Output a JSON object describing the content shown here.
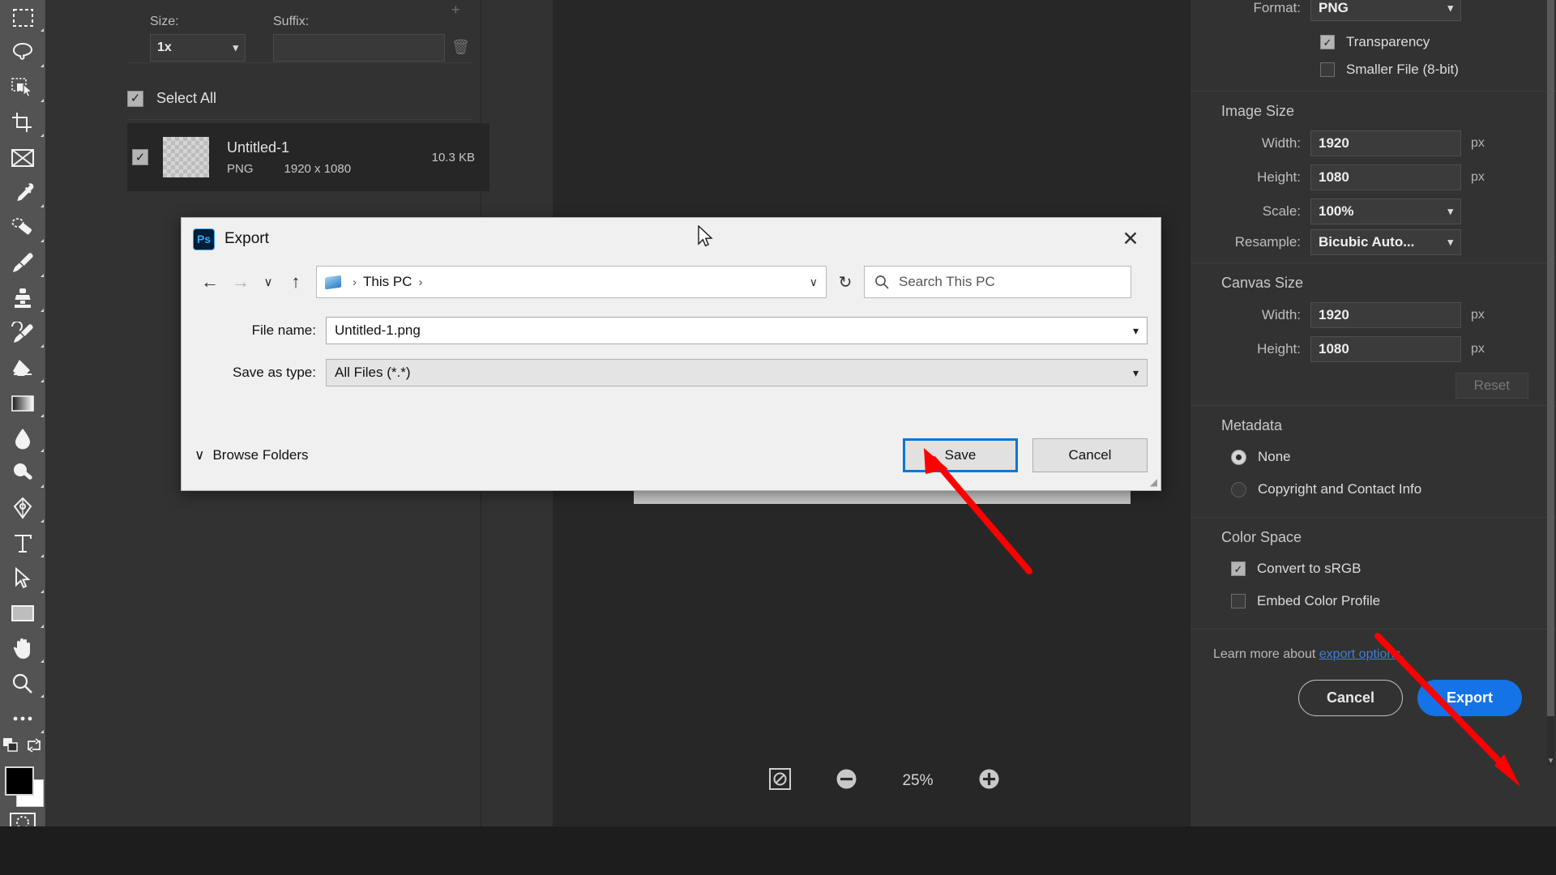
{
  "app": {
    "name": "Adobe Photoshop",
    "zoom_level": "25%"
  },
  "toolbar": {
    "tools": [
      {
        "name": "rectangular-marquee-tool"
      },
      {
        "name": "lasso-tool"
      },
      {
        "name": "object-selection-tool"
      },
      {
        "name": "crop-tool"
      },
      {
        "name": "frame-tool"
      },
      {
        "name": "eyedropper-tool"
      },
      {
        "name": "spot-healing-brush-tool"
      },
      {
        "name": "brush-tool"
      },
      {
        "name": "clone-stamp-tool"
      },
      {
        "name": "history-brush-tool"
      },
      {
        "name": "eraser-tool"
      },
      {
        "name": "gradient-tool"
      },
      {
        "name": "blur-tool"
      },
      {
        "name": "dodge-tool"
      },
      {
        "name": "pen-tool"
      },
      {
        "name": "type-tool"
      },
      {
        "name": "path-selection-tool"
      },
      {
        "name": "rectangle-tool"
      },
      {
        "name": "hand-tool"
      },
      {
        "name": "zoom-tool"
      },
      {
        "name": "edit-toolbar-tool"
      }
    ]
  },
  "export_left": {
    "size_label": "Size:",
    "suffix_label": "Suffix:",
    "size_value": "1x",
    "suffix_value": "",
    "select_all_label": "Select All",
    "select_all_checked": true,
    "asset": {
      "checked": true,
      "name": "Untitled-1",
      "format": "PNG",
      "dimensions": "1920 x 1080",
      "file_size": "10.3 KB"
    }
  },
  "export_right": {
    "format_label": "Format:",
    "format_value": "PNG",
    "transparency_label": "Transparency",
    "transparency_checked": true,
    "smaller_file_label": "Smaller File (8-bit)",
    "smaller_file_checked": false,
    "image_size_title": "Image Size",
    "image_width_label": "Width:",
    "image_width_value": "1920",
    "image_height_label": "Height:",
    "image_height_value": "1080",
    "scale_label": "Scale:",
    "scale_value": "100%",
    "resample_label": "Resample:",
    "resample_value": "Bicubic Auto...",
    "canvas_size_title": "Canvas Size",
    "canvas_width_label": "Width:",
    "canvas_width_value": "1920",
    "canvas_height_label": "Height:",
    "canvas_height_value": "1080",
    "unit": "px",
    "reset_label": "Reset",
    "metadata_title": "Metadata",
    "metadata_none_label": "None",
    "metadata_none_selected": true,
    "metadata_copyright_label": "Copyright and Contact Info",
    "color_space_title": "Color Space",
    "convert_srgb_label": "Convert to sRGB",
    "convert_srgb_checked": true,
    "embed_profile_label": "Embed Color Profile",
    "embed_profile_checked": false,
    "learn_more_prefix": "Learn more about",
    "learn_more_link": "export options.",
    "cancel_label": "Cancel",
    "export_label": "Export",
    "accent_color": "#1473e6",
    "link_color": "#3f7fd0"
  },
  "save_dialog": {
    "title": "Export",
    "app_badge": "Ps",
    "close_icon": "✕",
    "nav": {
      "back_icon": "←",
      "forward_icon": "→",
      "recent_icon": "∨",
      "up_icon": "↑",
      "refresh_icon": "↻"
    },
    "breadcrumb": {
      "root": "This PC",
      "separator": "›",
      "caret": "∨"
    },
    "search_placeholder": "Search This PC",
    "file_name_label": "File name:",
    "file_name_value": "Untitled-1.png",
    "save_as_type_label": "Save as type:",
    "save_as_type_value": "All Files (*.*)",
    "browse_folders_label": "Browse Folders",
    "browse_caret": "∨",
    "save_label": "Save",
    "cancel_label": "Cancel",
    "focus_color": "#0078d7"
  },
  "annotations": {
    "arrow_color": "#fe0000",
    "arrow_to_save_button": true,
    "arrow_to_export_button": true
  }
}
